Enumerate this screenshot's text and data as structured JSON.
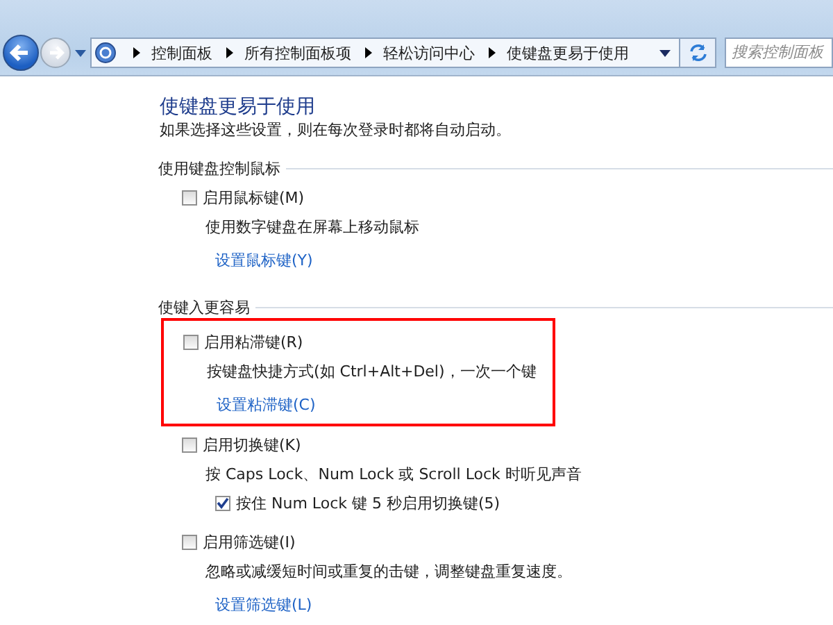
{
  "address_bar": {
    "breadcrumbs": [
      "控制面板",
      "所有控制面板项",
      "轻松访问中心",
      "使键盘更易于使用"
    ]
  },
  "search": {
    "placeholder": "搜索控制面板"
  },
  "page": {
    "title": "使键盘更易于使用",
    "subtitle": "如果选择这些设置，则在每次登录时都将自动启动。"
  },
  "sections": [
    {
      "title": "使用键盘控制鼠标",
      "options": [
        {
          "label": "启用鼠标键(M)",
          "checked": false,
          "highlighted": false,
          "description": "使用数字键盘在屏幕上移动鼠标",
          "link": "设置鼠标键(Y)"
        }
      ]
    },
    {
      "title": "使键入更容易",
      "options": [
        {
          "label": "启用粘滞键(R)",
          "checked": false,
          "highlighted": true,
          "description": "按键盘快捷方式(如 Ctrl+Alt+Del)，一次一个键",
          "link": "设置粘滞键(C)"
        },
        {
          "label": "启用切换键(K)",
          "checked": false,
          "highlighted": false,
          "description": "按 Caps Lock、Num Lock 或 Scroll Lock 时听见声音",
          "sub_options": [
            {
              "label": "按住 Num Lock 键 5 秒启用切换键(5)",
              "checked": true
            }
          ]
        },
        {
          "label": "启用筛选键(I)",
          "checked": false,
          "highlighted": false,
          "description": "忽略或减缓短时间或重复的击键，调整键盘重复速度。",
          "link": "设置筛选键(L)"
        }
      ]
    }
  ]
}
